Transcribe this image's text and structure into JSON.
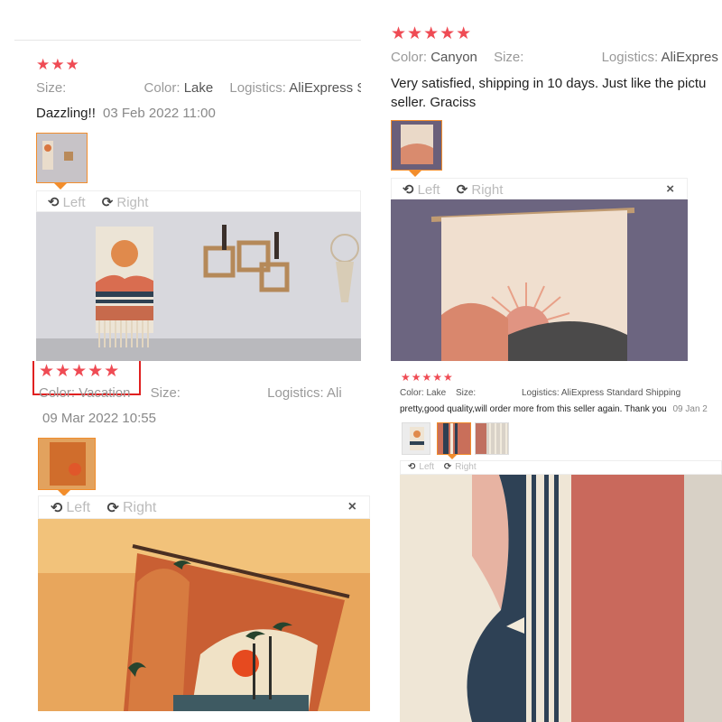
{
  "reviews": [
    {
      "stars": "★★★",
      "color_label": "Color:",
      "color_value": "Lake",
      "size_label": "Size:",
      "logistics_label": "Logistics:",
      "logistics_value": "AliExpress St",
      "text": "Dazzling!!",
      "date": "03 Feb 2022 11:00",
      "viewer": {
        "left": "Left",
        "right": "Right"
      }
    },
    {
      "stars": "★★★★★",
      "color_label": "Color:",
      "color_value": "Canyon",
      "size_label": "Size:",
      "logistics_label": "Logistics:",
      "logistics_value": "AliExpres",
      "text_line1": "Very satisfied, shipping in 10 days. Just like the pictu",
      "text_line2": "seller. Graciss",
      "viewer": {
        "left": "Left",
        "right": "Right",
        "close": "×"
      }
    },
    {
      "stars": "★★★★★",
      "color_label": "Color:",
      "color_value": "Vacation",
      "size_label": "Size:",
      "logistics_label": "Logistics:",
      "logistics_value": "Ali",
      "date": "09 Mar 2022 10:55",
      "viewer": {
        "left": "Left",
        "right": "Right",
        "close": "×"
      }
    },
    {
      "stars": "★★★★★",
      "color_label": "Color:",
      "color_value": "Lake",
      "size_label": "Size:",
      "logistics_label": "Logistics:",
      "logistics_value": "AliExpress Standard Shipping",
      "text": "pretty,good quality,will order more from this seller again. Thank you",
      "date": "09 Jan 2",
      "viewer": {
        "left": "Left",
        "right": "Right"
      }
    }
  ],
  "colors": {
    "star": "#ef4b54",
    "accent": "#f28d2c",
    "highlight": "#e02020"
  }
}
